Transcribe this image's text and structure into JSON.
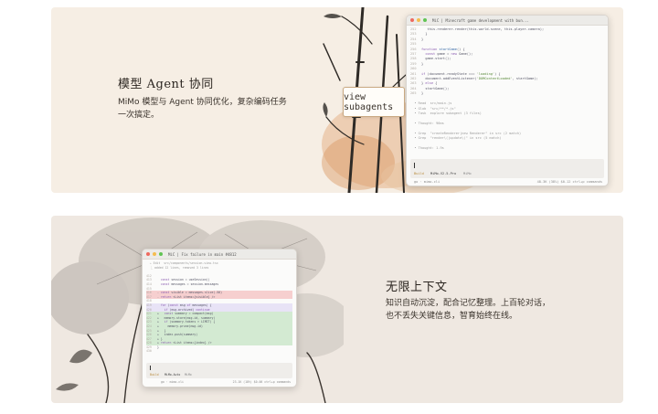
{
  "feature1": {
    "title": "模型 Agent 协同",
    "desc_line1": "MiMo 模型与 Agent 协同优化，复杂编码任务",
    "desc_line2": "一次搞定。",
    "window_title": "MiC | Minecraft game development with bun...",
    "callout": "view subagents",
    "mode_label": "Build",
    "model_label": "MiMo-V2.5-Pro",
    "provider_label": "MiMo",
    "footer_left": "go · mimo-cli",
    "footer_right": "48.3K (38%)  $0.12  ctrl+p commands"
  },
  "feature2": {
    "title": "无限上下文",
    "desc_line1": "知识自动沉淀，配合记忆整理。上百轮对话，",
    "desc_line2": "也不丢失关键信息，智育始终在线。",
    "window_title": "MiC | Fix failure in main #4812",
    "mode_label": "Build",
    "model_label": "MiMo-Auto",
    "provider_label": "MiMo",
    "footer_left": "go · mimo-cli",
    "footer_right": "23.1K (18%)  $0.06  ctrl+p commands"
  },
  "colors": {
    "card_top": "#f6eee4",
    "card_bottom": "#efe8e1",
    "callout_border": "#c9a982"
  }
}
